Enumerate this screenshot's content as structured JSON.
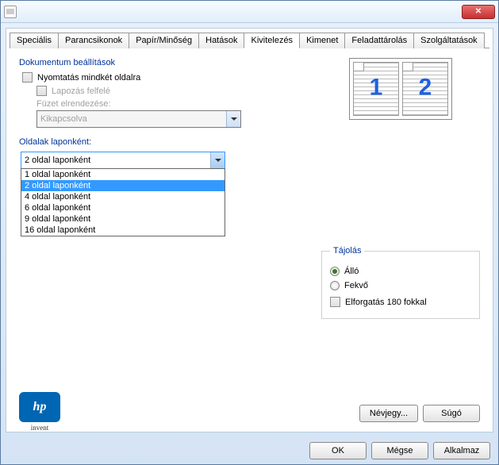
{
  "tabs": [
    "Speciális",
    "Parancsikonok",
    "Papír/Minőség",
    "Hatások",
    "Kivitelezés",
    "Kimenet",
    "Feladattárolás",
    "Szolgáltatások"
  ],
  "activeTab": 4,
  "docSettings": {
    "group": "Dokumentum beállítások",
    "printBoth": "Nyomtatás mindkét oldalra",
    "flipUp": "Lapozás felfelé",
    "bookletLabel": "Füzet elrendezése:",
    "bookletValue": "Kikapcsolva"
  },
  "pagesPerSheet": {
    "label": "Oldalak laponként:",
    "value": "2 oldal laponként",
    "options": [
      "1 oldal laponként",
      "2 oldal laponként",
      "4 oldal laponként",
      "6 oldal laponként",
      "9 oldal laponként",
      "16 oldal laponként"
    ],
    "selectedIndex": 1
  },
  "preview": {
    "page1": "1",
    "page2": "2"
  },
  "orientation": {
    "legend": "Tájolás",
    "portrait": "Álló",
    "landscape": "Fekvő",
    "rotate": "Elforgatás 180 fokkal",
    "selected": "portrait"
  },
  "buttons": {
    "about": "Névjegy...",
    "help": "Súgó",
    "ok": "OK",
    "cancel": "Mégse",
    "apply": "Alkalmaz"
  },
  "logo": {
    "text": "hp",
    "sub": "invent"
  }
}
